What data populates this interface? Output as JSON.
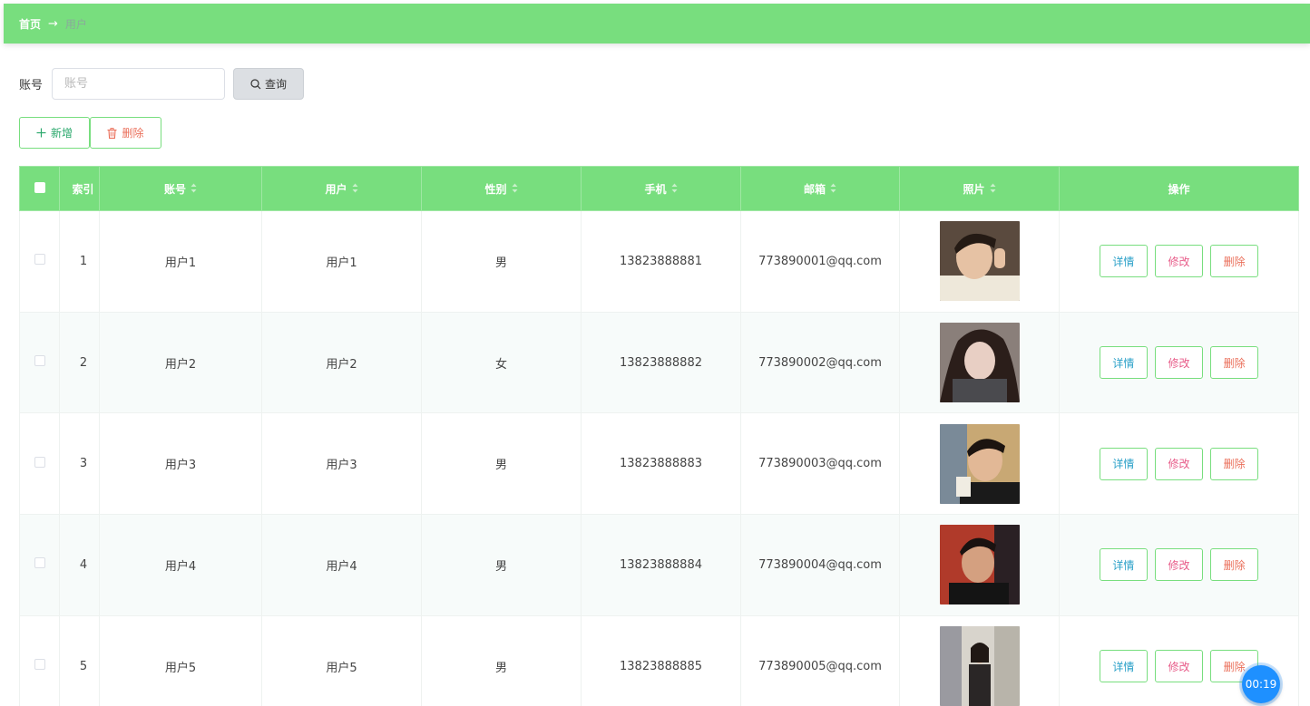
{
  "breadcrumb": {
    "home": "首页",
    "separator": "→",
    "current": "用户"
  },
  "search": {
    "label": "账号",
    "placeholder": "账号",
    "value": "",
    "button_label": "查询"
  },
  "actions": {
    "add_label": "新增",
    "delete_label": "删除"
  },
  "table": {
    "headers": {
      "index": "索引",
      "account": "账号",
      "user": "用户",
      "gender": "性别",
      "phone": "手机",
      "email": "邮箱",
      "photo": "照片",
      "operation": "操作"
    },
    "rows": [
      {
        "index": "1",
        "account": "用户1",
        "user": "用户1",
        "gender": "男",
        "phone": "13823888881",
        "email": "773890001@qq.com"
      },
      {
        "index": "2",
        "account": "用户2",
        "user": "用户2",
        "gender": "女",
        "phone": "13823888882",
        "email": "773890002@qq.com"
      },
      {
        "index": "3",
        "account": "用户3",
        "user": "用户3",
        "gender": "男",
        "phone": "13823888883",
        "email": "773890003@qq.com"
      },
      {
        "index": "4",
        "account": "用户4",
        "user": "用户4",
        "gender": "男",
        "phone": "13823888884",
        "email": "773890004@qq.com"
      },
      {
        "index": "5",
        "account": "用户5",
        "user": "用户5",
        "gender": "男",
        "phone": "13823888885",
        "email": "773890005@qq.com"
      }
    ],
    "row_buttons": {
      "detail": "详情",
      "edit": "修改",
      "delete": "删除"
    }
  },
  "timer": "00:19",
  "colors": {
    "accent": "#78de7e",
    "detail": "#2aa0c8",
    "edit": "#e85d8a",
    "delete": "#ea6f5a",
    "timer": "#1e90ff"
  },
  "icons": {
    "search": "search-icon",
    "add": "plus-icon",
    "delete": "trash-icon",
    "sort": "sort-icon"
  }
}
